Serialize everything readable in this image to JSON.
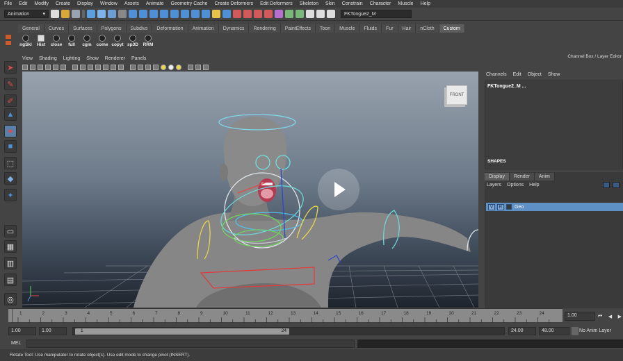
{
  "menubar": {
    "items": [
      "File",
      "Edit",
      "Modify",
      "Create",
      "Display",
      "Window",
      "Assets",
      "Animate",
      "Geometry Cache",
      "Create Deformers",
      "Edit Deformers",
      "Skeleton",
      "Skin",
      "Constrain",
      "Character",
      "Muscle",
      "Help"
    ]
  },
  "statusline": {
    "menuset": "Animation",
    "selected_object": "FKTongue2_M"
  },
  "shelf": {
    "tabs": [
      "General",
      "Curves",
      "Surfaces",
      "Polygons",
      "Subdivs",
      "Deformation",
      "Animation",
      "Dynamics",
      "Rendering",
      "PaintEffects",
      "Toon",
      "Muscle",
      "Fluids",
      "Fur",
      "Hair",
      "nCloth",
      "Custom"
    ],
    "active_tab": "Custom",
    "buttons": [
      "ngSki",
      "Hist",
      "close",
      "full",
      "cgm",
      "come",
      "copyt",
      "sp3D",
      "RRM"
    ]
  },
  "viewport": {
    "menu": [
      "View",
      "Shading",
      "Lighting",
      "Show",
      "Renderer",
      "Panels"
    ],
    "viewcube_label": "FRONT"
  },
  "channelbox": {
    "title": "Channel Box / Layer Editor",
    "menu": [
      "Channels",
      "Edit",
      "Object",
      "Show"
    ],
    "object_name": "FKTongue2_M ...",
    "shapes_label": "SHAPES"
  },
  "layers": {
    "tabs": [
      "Display",
      "Render",
      "Anim"
    ],
    "active_tab": "Display",
    "menu": [
      "Layers",
      "Options",
      "Help"
    ],
    "row": {
      "v": "V",
      "r": "R",
      "name": "Geo"
    }
  },
  "timeline": {
    "ticks": [
      "1",
      "2",
      "3",
      "4",
      "5",
      "6",
      "7",
      "8",
      "9",
      "10",
      "11",
      "12",
      "13",
      "14",
      "15",
      "16",
      "17",
      "18",
      "19",
      "20",
      "21",
      "22",
      "23",
      "24"
    ],
    "current_frame": "1.00"
  },
  "range": {
    "start_anim": "1.00",
    "start": "1.00",
    "slider_start": "1",
    "slider_end": "24",
    "end": "24.00",
    "end_anim": "48.00",
    "anim_layer": "No Anim Layer"
  },
  "cmdline": {
    "label": "MEL"
  },
  "helpline": {
    "text": "Rotate Tool: Use manipulator to rotate object(s). Use edit mode to change pivot (INSERT)."
  },
  "colors": {
    "layer_highlight": "#5e8fc5",
    "active_tab": "#5d5d5d"
  }
}
